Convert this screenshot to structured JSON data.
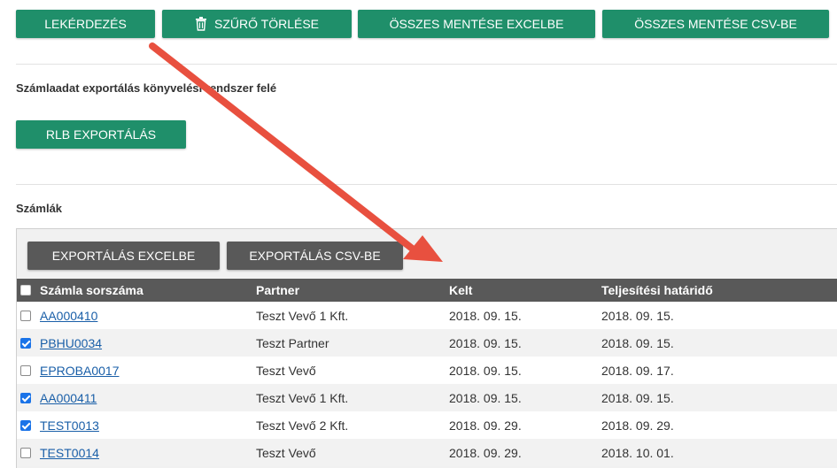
{
  "toolbar": {
    "query_label": "LEKÉRDEZÉS",
    "clear_filter_label": "SZŰRŐ TÖRLÉSE",
    "save_all_excel_label": "ÖSSZES MENTÉSE EXCELBE",
    "save_all_csv_label": "ÖSSZES MENTÉSE CSV-BE"
  },
  "export_section": {
    "title": "Számlaadat exportálás könyvelési rendszer felé",
    "rlb_button_label": "RLB EXPORTÁLÁS"
  },
  "invoices": {
    "title": "Számlák",
    "export_excel_label": "EXPORTÁLÁS EXCELBE",
    "export_csv_label": "EXPORTÁLÁS CSV-BE",
    "columns": {
      "number": "Számla sorszáma",
      "partner": "Partner",
      "issued": "Kelt",
      "due": "Teljesítési határidő"
    },
    "rows": [
      {
        "number": "AA000410",
        "partner": "Teszt Vevő 1 Kft.",
        "issued": "2018. 09. 15.",
        "due": "2018. 09. 15.",
        "checked": false
      },
      {
        "number": "PBHU0034",
        "partner": "Teszt Partner",
        "issued": "2018. 09. 15.",
        "due": "2018. 09. 15.",
        "checked": true
      },
      {
        "number": "EPROBA0017",
        "partner": "Teszt Vevő",
        "issued": "2018. 09. 15.",
        "due": "2018. 09. 17.",
        "checked": false
      },
      {
        "number": "AA000411",
        "partner": "Teszt Vevő 1 Kft.",
        "issued": "2018. 09. 15.",
        "due": "2018. 09. 15.",
        "checked": true
      },
      {
        "number": "TEST0013",
        "partner": "Teszt Vevő 2 Kft.",
        "issued": "2018. 09. 29.",
        "due": "2018. 09. 29.",
        "checked": true
      },
      {
        "number": "TEST0014",
        "partner": "Teszt Vevő",
        "issued": "2018. 09. 29.",
        "due": "2018. 10. 01.",
        "checked": false
      }
    ]
  },
  "colors": {
    "primary_green": "#1f8f6a",
    "dark_gray": "#595959",
    "link_blue": "#1a5fa8",
    "checkbox_blue": "#1a73e8",
    "annotation_arrow": "#e8503f"
  },
  "icons": {
    "clear_filter": "trash-icon",
    "annotation": "red-arrow-annotation"
  }
}
